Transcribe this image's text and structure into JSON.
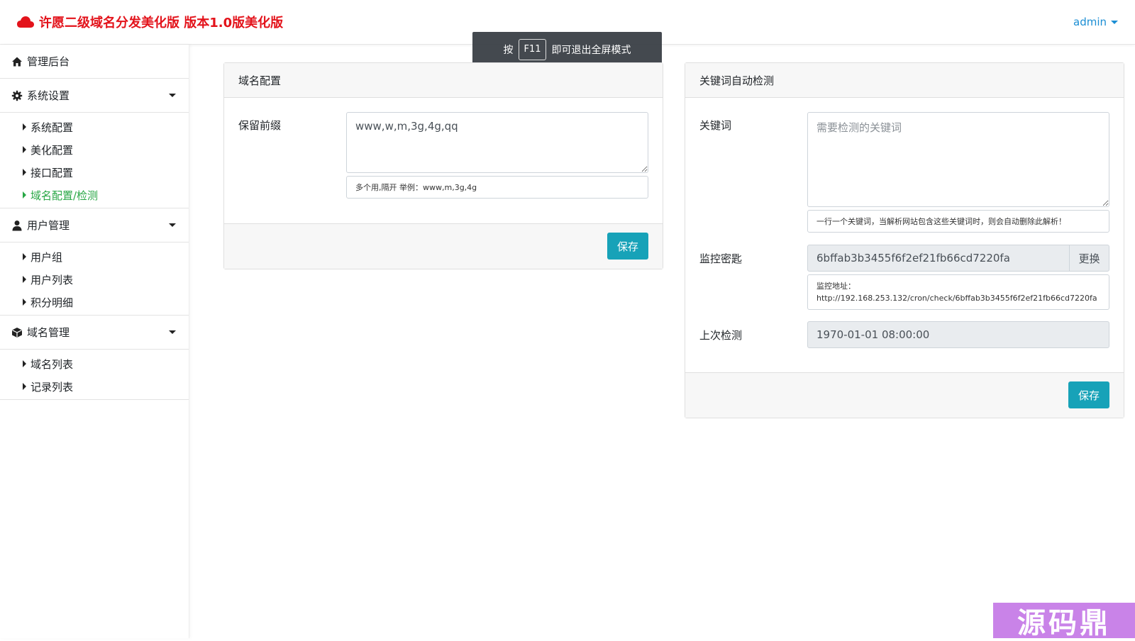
{
  "navbar": {
    "brand_title": "许愿二级域名分发美化版 版本1.0版美化版",
    "user": "admin",
    "brand_color": "#e3131b",
    "link_color": "#1b8ed4"
  },
  "toast": {
    "prefix": "按",
    "key": "F11",
    "suffix": "即可退出全屏模式"
  },
  "sidebar": {
    "dashboard": "管理后台",
    "system": {
      "label": "系统设置",
      "items": [
        "系统配置",
        "美化配置",
        "接口配置",
        "域名配置/检测"
      ]
    },
    "users": {
      "label": "用户管理",
      "items": [
        "用户组",
        "用户列表",
        "积分明细"
      ]
    },
    "domains": {
      "label": "域名管理",
      "items": [
        "域名列表",
        "记录列表"
      ]
    },
    "active_item": "域名配置/检测",
    "active_color": "#28a745"
  },
  "domain_config": {
    "title": "域名配置",
    "reserved_label": "保留前缀",
    "reserved_value": "www,w,m,3g,4g,qq",
    "reserved_help": "多个用,隔开 举例：www,m,3g,4g",
    "save_label": "保存"
  },
  "keyword_check": {
    "title": "关键词自动检测",
    "keyword_label": "关键词",
    "keyword_placeholder": "需要检测的关键词",
    "keyword_help": "一行一个关键词，当解析网站包含这些关键词时，则会自动删除此解析！",
    "key_label": "监控密匙",
    "key_value": "6bffab3b3455f6f2ef21fb66cd7220fa",
    "replace_label": "更换",
    "monitor_url_label": "监控地址：",
    "monitor_url": "http://192.168.253.132/cron/check/6bffab3b3455f6f2ef21fb66cd7220fa",
    "last_check_label": "上次检测",
    "last_check_value": "1970-01-01 08:00:00",
    "save_label": "保存",
    "button_color": "#17a2b8"
  },
  "watermark": {
    "text": "源码鼎"
  }
}
